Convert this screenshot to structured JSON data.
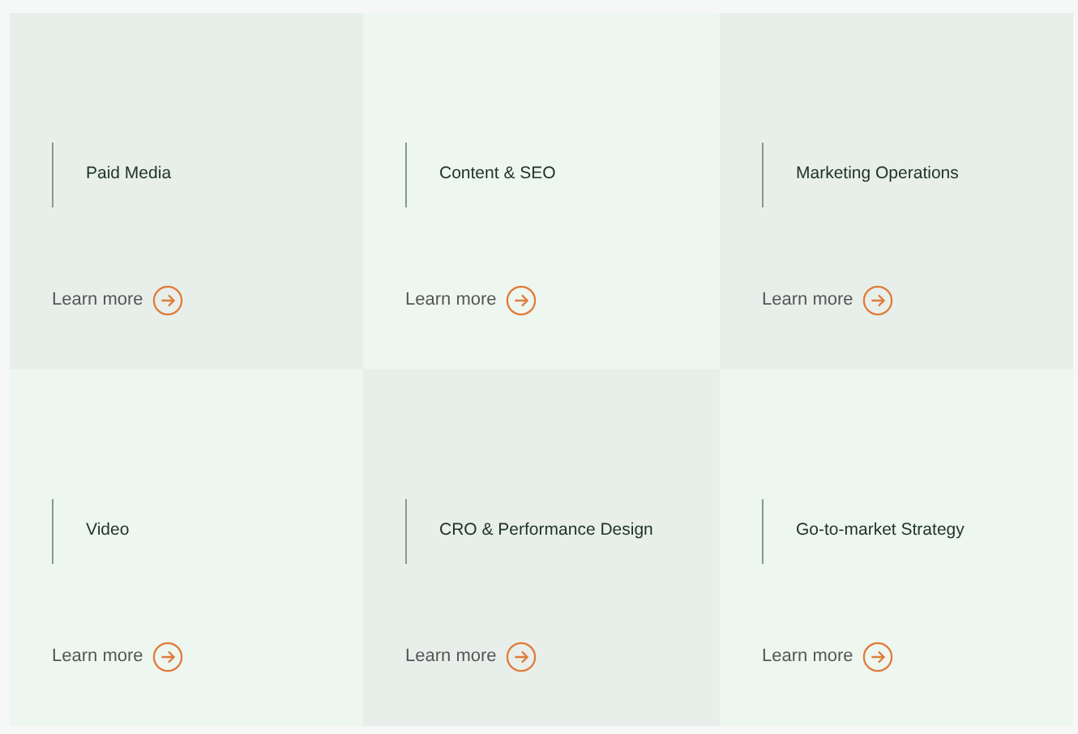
{
  "cards": [
    {
      "title": "Paid Media",
      "link": "Learn more",
      "color": "#e8efea"
    },
    {
      "title": "Content & SEO",
      "link": "Learn more",
      "color": "#eef6f0"
    },
    {
      "title": "Marketing Operations",
      "link": "Learn more",
      "color": "#e8efea"
    },
    {
      "title": "Video",
      "link": "Learn more",
      "color": "#eef6f0"
    },
    {
      "title": "CRO & Performance Design",
      "link": "Learn more",
      "color": "#e8efea"
    },
    {
      "title": "Go-to-market Strategy",
      "link": "Learn more",
      "color": "#eef6f0"
    }
  ]
}
